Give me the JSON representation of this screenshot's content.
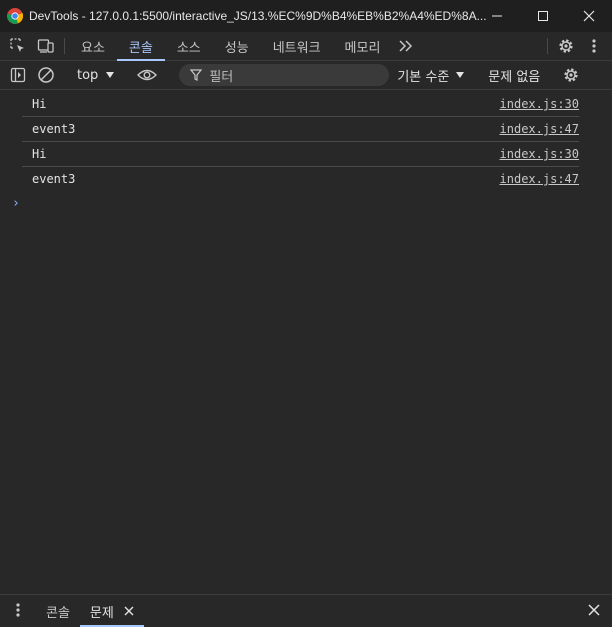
{
  "window": {
    "title": "DevTools - 127.0.0.1:5500/interactive_JS/13.%EC%9D%B4%EB%B2%A4%ED%8A..."
  },
  "main_tabs": [
    {
      "label": "요소",
      "active": false
    },
    {
      "label": "콘솔",
      "active": true
    },
    {
      "label": "소스",
      "active": false
    },
    {
      "label": "성능",
      "active": false
    },
    {
      "label": "네트워크",
      "active": false
    },
    {
      "label": "메모리",
      "active": false
    }
  ],
  "toolbar": {
    "context": "top",
    "filter_placeholder": "필터",
    "levels": "기본 수준",
    "issues": "문제 없음"
  },
  "console": {
    "messages": [
      {
        "text": "Hi",
        "source": "index.js:30"
      },
      {
        "text": "event3",
        "source": "index.js:47"
      },
      {
        "text": "Hi",
        "source": "index.js:30"
      },
      {
        "text": "event3",
        "source": "index.js:47"
      }
    ],
    "prompt": "›"
  },
  "drawer": {
    "tabs": [
      {
        "label": "콘솔",
        "active": false
      },
      {
        "label": "문제",
        "active": true
      }
    ]
  },
  "colors": {
    "background": "#282828",
    "accent": "#a8c7fa",
    "prompt": "#8ab4f8"
  }
}
